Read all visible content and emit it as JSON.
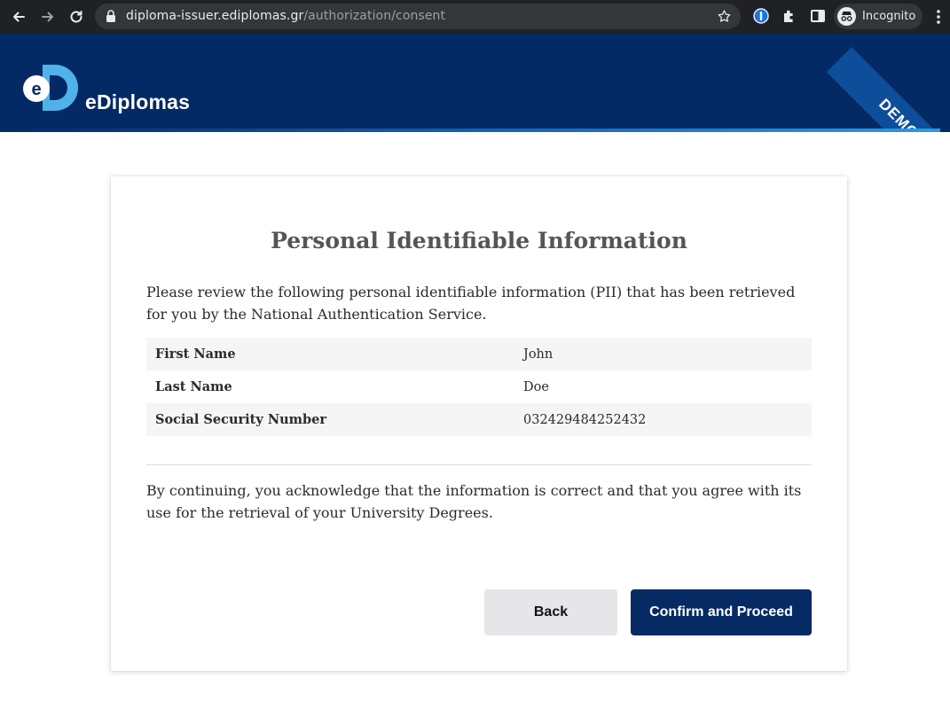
{
  "browser": {
    "url_host": "diploma-issuer.ediplomas.gr",
    "url_path": "/authorization/consent",
    "incognito_label": "Incognito",
    "icons": [
      "back-arrow-icon",
      "forward-arrow-icon",
      "reload-icon",
      "lock-icon",
      "star-icon",
      "password-manager-icon",
      "extensions-icon",
      "side-panel-icon",
      "incognito-icon",
      "more-menu-icon"
    ]
  },
  "header": {
    "logo_text": "eDiplomas",
    "ribbon": "DEMO",
    "colors": {
      "background": "#042a65",
      "logo_light": "#4fb3ea",
      "logo_dark": "#1a8fd8"
    }
  },
  "card": {
    "title": "Personal Identifiable Information",
    "intro": "Please review the following personal identifiable information (PII) that has been retrieved for you by the National Authentication Service.",
    "rows": [
      {
        "label": "First Name",
        "value": "John"
      },
      {
        "label": "Last Name",
        "value": "Doe"
      },
      {
        "label": "Social Security Number",
        "value": "032429484252432"
      }
    ],
    "consent": "By continuing, you acknowledge that the information is correct and that you agree with its use for the retrieval of your University Degrees.",
    "back_label": "Back",
    "confirm_label": "Confirm and Proceed",
    "colors": {
      "confirm_button": "#062a63",
      "back_button": "#e6e6e9"
    }
  }
}
